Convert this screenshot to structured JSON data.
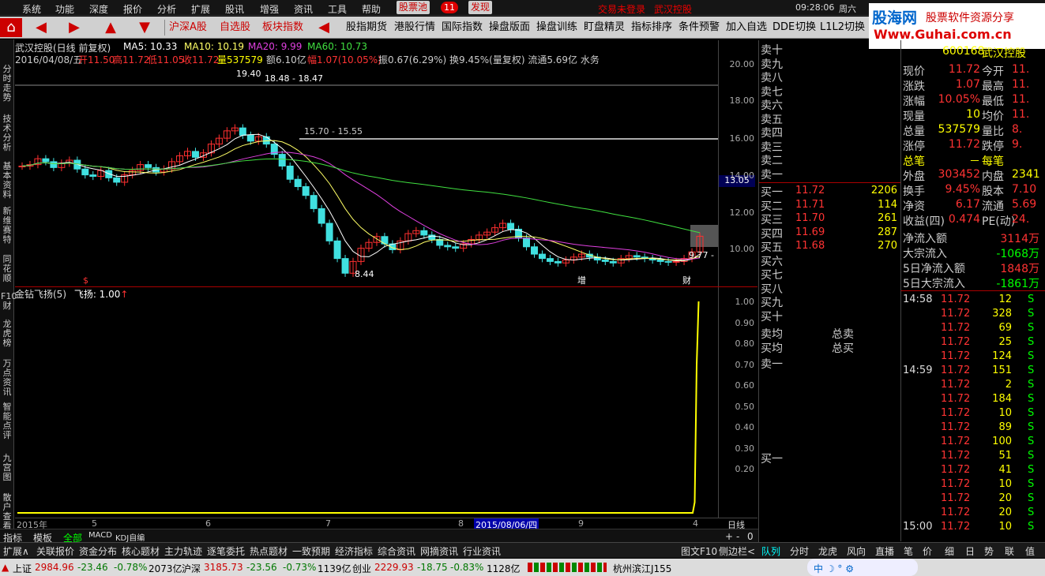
{
  "menu": {
    "items": [
      "系统",
      "功能",
      "深度",
      "报价",
      "分析",
      "扩展",
      "股讯",
      "增强",
      "资讯",
      "工具",
      "帮助"
    ],
    "stock_pool": "股票池",
    "badge": "11",
    "discover": "发现",
    "login": "交易未登录",
    "stock_name": "武汉控股",
    "time": "09:28:06",
    "weekday": "周六"
  },
  "toolbar": {
    "items": [
      "沪深A股",
      "自选股",
      "板块指数",
      "股指期货",
      "港股行情",
      "国际指数",
      "操盘版面",
      "操盘训练",
      "盯盘精灵",
      "指标排序",
      "条件预警",
      "加入自选",
      "DDE",
      "切换",
      "L1L2切换"
    ]
  },
  "logo": {
    "title": "股海网",
    "slogan": "股票软件资源分享",
    "url": "Www.Guhai.com.cn"
  },
  "chart": {
    "title": "武汉控股(日线 前复权)",
    "ma5": "MA5: 10.33",
    "ma10": "MA10: 10.19",
    "ma20": "MA20: 9.99",
    "ma60": "MA60: 10.73",
    "info_date": "2016/04/08/五",
    "info_open": "开11.50",
    "info_high": "高11.72",
    "info_low": "低11.05",
    "info_close": "收11.72",
    "info_vol": "量537579",
    "info_amt": "额6.10亿",
    "info_pct": "幅1.07(10.05%)",
    "info_rest": "振0.67(6.29%) 换9.45%(量复权) 流通5.69亿 水务",
    "price_ticks": [
      "20.00",
      "18.00",
      "16.00",
      "14.00",
      "12.00",
      "10.00"
    ],
    "current_price": "13.05",
    "ann_high": "19.40",
    "ann_range1": "18.48 - 18.47",
    "ann_range2": "15.70 - 15.55",
    "ann_low": "8.44",
    "ann_right": "9.77 -",
    "ann_s": "$",
    "ann_zeng": "增",
    "ann_cai": "财",
    "osc_title": "金钻飞扬(5)",
    "osc_value": "飞扬: 1.00",
    "osc_ticks": [
      "1.00",
      "0.90",
      "0.80",
      "0.70",
      "0.60",
      "0.50",
      "0.40",
      "0.30",
      "0.20"
    ],
    "x_labels": [
      "2015年",
      "5",
      "6",
      "7",
      "8",
      "9",
      "4"
    ],
    "cursor_date": "2015/08/06/四",
    "period": "日线",
    "zoom": [
      "+",
      "-",
      "0"
    ]
  },
  "chart_data": {
    "type": "line",
    "series": [
      {
        "name": "飞扬",
        "values": [
          0,
          0,
          0,
          0,
          0,
          0,
          0,
          0,
          0,
          0,
          0,
          0,
          0,
          0,
          0,
          0,
          0,
          0,
          0,
          0,
          0.05,
          0.7,
          1.0
        ]
      }
    ],
    "ylim": [
      0,
      1.0
    ]
  },
  "sidetabs": [
    "分时走势",
    "技术分析",
    "基本资料",
    "新维赛特",
    "同花顺",
    "F10财",
    "龙虎榜",
    "万点资讯",
    "智能点评",
    "九宫图",
    "散户查看"
  ],
  "orderbook": {
    "sells": [
      "卖十",
      "卖九",
      "卖八",
      "卖七",
      "卖六",
      "卖五",
      "卖四",
      "卖三",
      "卖二",
      "卖一"
    ],
    "buys": [
      {
        "label": "买一",
        "price": "11.72",
        "vol": "2206"
      },
      {
        "label": "买二",
        "price": "11.71",
        "vol": "114"
      },
      {
        "label": "买三",
        "price": "11.70",
        "vol": "261"
      },
      {
        "label": "买四",
        "price": "11.69",
        "vol": "287"
      },
      {
        "label": "买五",
        "price": "11.68",
        "vol": "270"
      },
      {
        "label": "买六"
      },
      {
        "label": "买七"
      },
      {
        "label": "买八"
      },
      {
        "label": "买九"
      },
      {
        "label": "买十"
      }
    ],
    "avg_sell": "卖均",
    "avg_buy": "买均",
    "total_sell": "总卖",
    "total_buy": "总买",
    "bottom_sell": "卖一",
    "bottom_buy": "买一"
  },
  "quote": {
    "code": "600168",
    "name": "武汉控股",
    "rows": [
      [
        "现价",
        "11.72",
        "今开",
        "11."
      ],
      [
        "涨跌",
        "1.07",
        "最高",
        "11."
      ],
      [
        "涨幅",
        "10.05%",
        "最低",
        "11."
      ],
      [
        "现量",
        "10",
        "均价",
        "11."
      ],
      [
        "总量",
        "537579",
        "量比",
        "8."
      ],
      [
        "涨停",
        "11.72",
        "跌停",
        "9."
      ],
      [
        "总笔",
        "－",
        "每笔",
        ""
      ],
      [
        "外盘",
        "303452",
        "内盘",
        "2341"
      ],
      [
        "换手",
        "9.45%",
        "股本",
        "7.10"
      ],
      [
        "净资",
        "6.17",
        "流通",
        "5.69"
      ],
      [
        "收益(四)",
        "0.474",
        "PE(动)",
        "24."
      ]
    ],
    "flow": [
      [
        "净流入额",
        "3114万"
      ],
      [
        "大宗流入",
        "-1068万"
      ],
      [
        "5日净流入额",
        "1848万"
      ],
      [
        "5日大宗流入",
        "-1861万"
      ]
    ]
  },
  "ticks": [
    [
      "14:58",
      "11.72",
      "12",
      "S"
    ],
    [
      "",
      "11.72",
      "328",
      "S"
    ],
    [
      "",
      "11.72",
      "69",
      "S"
    ],
    [
      "",
      "11.72",
      "25",
      "S"
    ],
    [
      "",
      "11.72",
      "124",
      "S"
    ],
    [
      "14:59",
      "11.72",
      "151",
      "S"
    ],
    [
      "",
      "11.72",
      "2",
      "S"
    ],
    [
      "",
      "11.72",
      "184",
      "S"
    ],
    [
      "",
      "11.72",
      "10",
      "S"
    ],
    [
      "",
      "11.72",
      "89",
      "S"
    ],
    [
      "",
      "11.72",
      "100",
      "S"
    ],
    [
      "",
      "11.72",
      "51",
      "S"
    ],
    [
      "",
      "11.72",
      "41",
      "S"
    ],
    [
      "",
      "11.72",
      "10",
      "S"
    ],
    [
      "",
      "11.72",
      "20",
      "S"
    ],
    [
      "",
      "11.72",
      "20",
      "S"
    ],
    [
      "15:00",
      "11.72",
      "10",
      "S"
    ]
  ],
  "bottomtabs": [
    "指标",
    "模板",
    "全部",
    "MACD",
    "KDJ自编"
  ],
  "infotabs": [
    "扩展∧",
    "关联报价",
    "资金分布",
    "核心题材",
    "主力轨迹",
    "逐笔委托",
    "热点题材",
    "一致预期",
    "经济指标",
    "综合资讯",
    "网摘资讯",
    "行业资讯"
  ],
  "rightinfo": [
    "图文F10",
    "侧边栏<"
  ],
  "rightpanel_tabs": [
    "队列",
    "分时",
    "龙虎",
    "风向",
    "直播",
    "笔",
    "价",
    "细",
    "日",
    "势",
    "联",
    "值"
  ],
  "status": {
    "sh_label": "上证",
    "sh_val": "2984.96",
    "sh_chg": "-23.46",
    "sh_pct": "-0.78%",
    "sh_amt": "2073亿",
    "hs_label": "沪深",
    "hs_val": "3185.73",
    "hs_chg": "-23.56",
    "hs_pct": "-0.73%",
    "hs_amt": "1139亿",
    "cy_label": "创业",
    "cy_val": "2229.93",
    "cy_chg": "-18.75",
    "cy_pct": "-0.83%",
    "cy_amt": "1128亿",
    "server": "杭州滨江J155"
  }
}
